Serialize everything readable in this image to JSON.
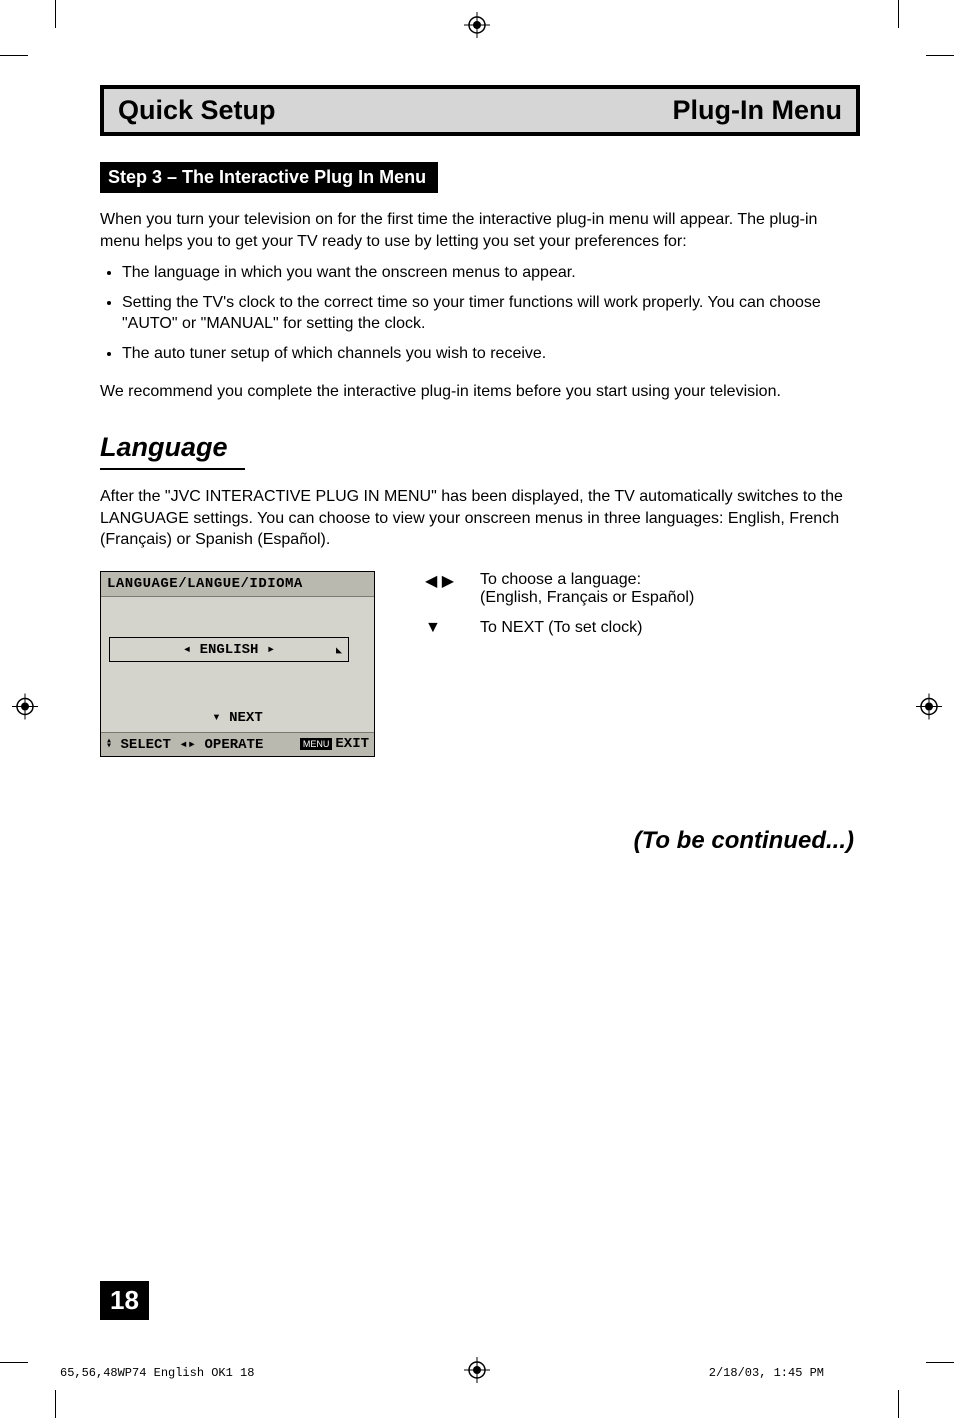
{
  "titleBar": {
    "left": "Quick Setup",
    "right": "Plug-In Menu"
  },
  "stepHeader": "Step 3 – The Interactive Plug In Menu",
  "intro": "When you turn your television on for the first time the interactive plug-in menu will appear. The plug-in menu helps you to get your TV ready to use by letting you set your preferences for:",
  "bullets": [
    "The language in which you want the onscreen menus to appear.",
    "Setting the TV's clock to the correct time so your timer functions will work properly. You can choose \"AUTO\" or \"MANUAL\" for setting the clock.",
    "The auto tuner setup of which channels you wish to receive."
  ],
  "outro": "We recommend you complete the interactive plug-in items before you start using your television.",
  "sectionHeading": "Language",
  "sectionBody": "After the \"JVC INTERACTIVE PLUG IN MENU\" has been displayed, the TV automatically switches to the LANGUAGE settings. You can choose to view your onscreen menus in three languages:  English, French (Français) or Spanish (Español).",
  "osd": {
    "header": "LANGUAGE/LANGUE/IDIOMA",
    "fieldLeftGlyph": "◂",
    "fieldValue": "ENGLISH",
    "fieldRightGlyph": "▸",
    "nextGlyph": "▾",
    "nextLabel": "NEXT",
    "footerSelectGlyph": "▴▾",
    "footerSelectLabel": "SELECT",
    "footerOperateGlyph": "◂▸",
    "footerOperateLabel": "OPERATE",
    "footerMenuTag": "MENU",
    "footerExit": "EXIT"
  },
  "instructions": {
    "row1Icon": "◀ ▶",
    "row1a": "To choose a language:",
    "row1b": "(English, Français or Español)",
    "row2Icon": "▼",
    "row2": "To NEXT (To set clock)"
  },
  "continued": "(To be continued...)",
  "pageNumber": "18",
  "footerLeft": "65,56,48WP74 English OK1  18",
  "footerRight": "2/18/03, 1:45 PM"
}
